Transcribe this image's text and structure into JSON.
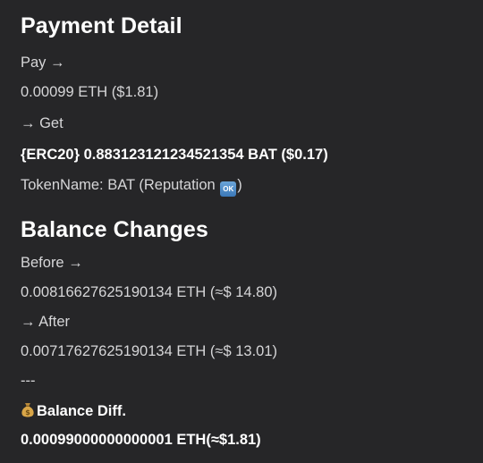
{
  "payment": {
    "title": "Payment Detail",
    "pay_label": "Pay →",
    "pay_amount": "0.00099 ETH ($1.81)",
    "get_label": "→ Get",
    "get_amount": "{ERC20} 0.883123121234521354 BAT ($0.17)",
    "token_prefix": "TokenName: BAT (Reputation",
    "token_badge": "OK",
    "token_suffix": ")"
  },
  "balance": {
    "title": "Balance Changes",
    "before_label": "Before →",
    "before_amount": "0.00816627625190134 ETH (≈$ 14.80)",
    "after_label": "→ After",
    "after_amount": "0.00717627625190134 ETH (≈$ 13.01)",
    "separator": "---",
    "diff_icon": "money-bag-icon",
    "diff_label": "Balance Diff.",
    "diff_amount": "0.00099000000000001 ETH(≈$1.81)"
  },
  "colors": {
    "background": "#262628",
    "text": "#d6d6d8",
    "heading": "#ffffff",
    "badge": "#4a8cc9"
  }
}
